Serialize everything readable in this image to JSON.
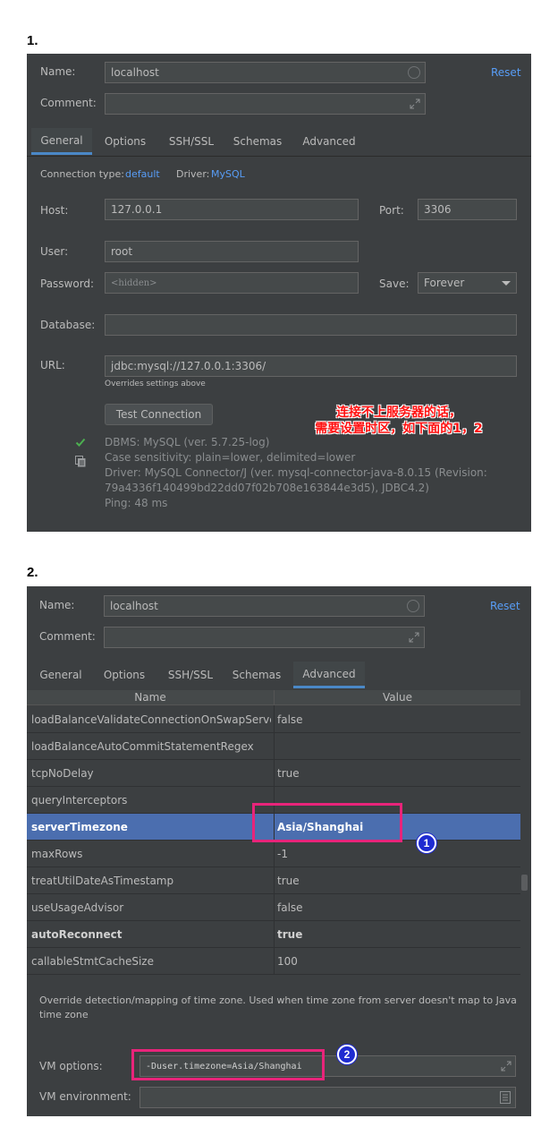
{
  "section1": {
    "number": "1.",
    "name_label": "Name:",
    "name_value": "localhost",
    "reset": "Reset",
    "comment_label": "Comment:",
    "tabs": [
      "General",
      "Options",
      "SSH/SSL",
      "Schemas",
      "Advanced"
    ],
    "active_tab": "General",
    "conn_type_label": "Connection type:",
    "conn_type_value": "default",
    "driver_label": "Driver:",
    "driver_value": "MySQL",
    "host_label": "Host:",
    "host_value": "127.0.0.1",
    "port_label": "Port:",
    "port_value": "3306",
    "user_label": "User:",
    "user_value": "root",
    "password_label": "Password:",
    "password_placeholder": "<hidden>",
    "save_label": "Save:",
    "save_value": "Forever",
    "database_label": "Database:",
    "url_label": "URL:",
    "url_value": "jdbc:mysql://127.0.0.1:3306/",
    "url_hint": "Overrides settings above",
    "test_button": "Test Connection",
    "annotation_line1": "连接不上服务器的话，",
    "annotation_line2": "需要设置时区，如下面的1，2",
    "status": {
      "dbms": "DBMS: MySQL (ver. 5.7.25-log)",
      "case": "Case sensitivity: plain=lower, delimited=lower",
      "driver_line1": "Driver: MySQL Connector/J (ver. mysql-connector-java-8.0.15 (Revision:",
      "driver_line2": "79a4336f140499bd22dd07f02b708e163844e3d5), JDBC4.2)",
      "ping": "Ping: 48 ms"
    },
    "colors": {
      "ok": "#4caf50",
      "link": "#589df6"
    }
  },
  "section2": {
    "number": "2.",
    "name_label": "Name:",
    "name_value": "localhost",
    "reset": "Reset",
    "comment_label": "Comment:",
    "tabs": [
      "General",
      "Options",
      "SSH/SSL",
      "Schemas",
      "Advanced"
    ],
    "active_tab": "Advanced",
    "table_headers": {
      "name": "Name",
      "value": "Value"
    },
    "rows": [
      {
        "name": "loadBalanceValidateConnectionOnSwapServer",
        "value": "false"
      },
      {
        "name": "loadBalanceAutoCommitStatementRegex",
        "value": ""
      },
      {
        "name": "tcpNoDelay",
        "value": "true"
      },
      {
        "name": "queryInterceptors",
        "value": ""
      },
      {
        "name": "serverTimezone",
        "value": "Asia/Shanghai"
      },
      {
        "name": "maxRows",
        "value": "-1"
      },
      {
        "name": "treatUtilDateAsTimestamp",
        "value": "true"
      },
      {
        "name": "useUsageAdvisor",
        "value": "false"
      },
      {
        "name": "autoReconnect",
        "value": "true"
      },
      {
        "name": "callableStmtCacheSize",
        "value": "100"
      }
    ],
    "description": "Override detection/mapping of time zone. Used when time zone from server doesn't map to Java time zone",
    "vm_options_label": "VM options:",
    "vm_options_value": "-Duser.timezone=Asia/Shanghai",
    "vm_env_label": "VM environment:",
    "badges": [
      "1",
      "2"
    ],
    "colors": {
      "selection": "#4b6eaf",
      "highlight": "#e8247a",
      "badge": "#1f2bd1"
    }
  }
}
